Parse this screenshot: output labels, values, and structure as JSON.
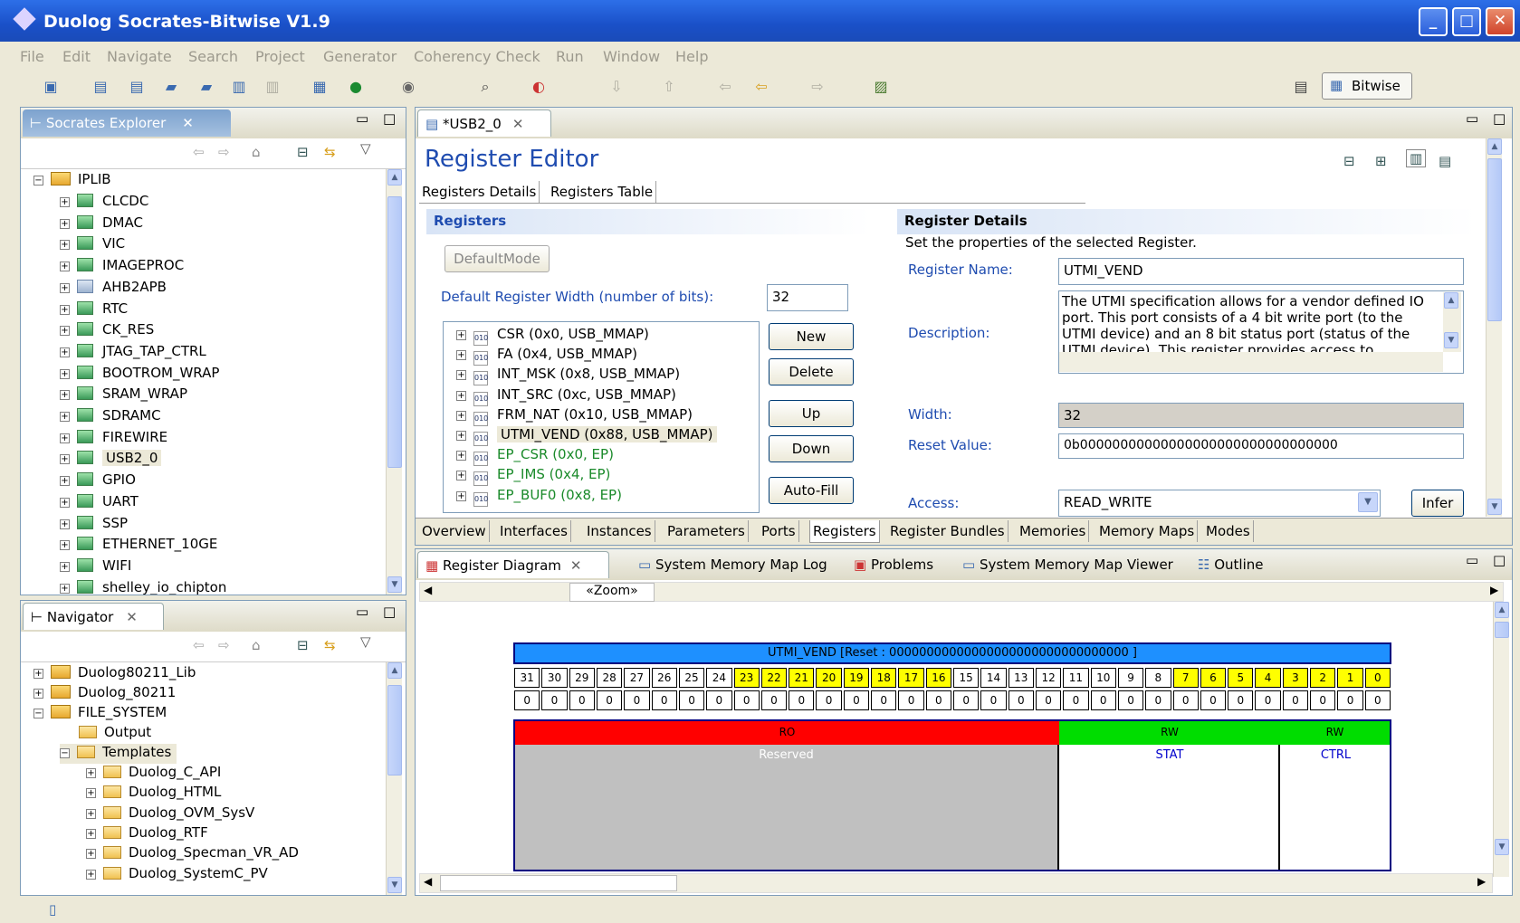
{
  "window": {
    "title": "Duolog Socrates-Bitwise V1.9"
  },
  "menu": [
    "File",
    "Edit",
    "Navigate",
    "Search",
    "Project",
    "Generator",
    "Coherency Check",
    "Run",
    "Window",
    "Help"
  ],
  "perspective": {
    "label": "Bitwise"
  },
  "explorer": {
    "title": "Socrates Explorer",
    "root": "IPLIB",
    "items": [
      "CLCDC",
      "DMAC",
      "VIC",
      "IMAGEPROC",
      "AHB2APB",
      "RTC",
      "CK_RES",
      "JTAG_TAP_CTRL",
      "BOOTROM_WRAP",
      "SRAM_WRAP",
      "SDRAMC",
      "FIREWIRE",
      "USB2_0",
      "GPIO",
      "UART",
      "SSP",
      "ETHERNET_10GE",
      "WIFI",
      "shelley_io_chipton"
    ]
  },
  "navigator": {
    "title": "Navigator",
    "projects": [
      "Duolog80211_Lib",
      "Duolog_80211",
      "FILE_SYSTEM"
    ],
    "folders": [
      "Output",
      "Templates"
    ],
    "templates": [
      "Duolog_C_API",
      "Duolog_HTML",
      "Duolog_OVM_SysV",
      "Duolog_RTF",
      "Duolog_Specman_VR_AD",
      "Duolog_SystemC_PV"
    ]
  },
  "editor": {
    "tab": "*USB2_0",
    "heading": "Register Editor",
    "subtabs": [
      "Registers Details",
      "Registers Table"
    ],
    "registers_section": "Registers",
    "default_mode_btn": "DefaultMode",
    "width_label": "Default Register Width (number of bits):",
    "width_value": "32",
    "register_list": [
      {
        "name": "CSR (0x0, USB_MMAP)",
        "green": false
      },
      {
        "name": "FA (0x4, USB_MMAP)",
        "green": false
      },
      {
        "name": "INT_MSK (0x8, USB_MMAP)",
        "green": false
      },
      {
        "name": "INT_SRC (0xc, USB_MMAP)",
        "green": false
      },
      {
        "name": "FRM_NAT (0x10, USB_MMAP)",
        "green": false
      },
      {
        "name": "UTMI_VEND (0x88, USB_MMAP)",
        "green": false
      },
      {
        "name": "EP_CSR (0x0, EP)",
        "green": true
      },
      {
        "name": "EP_IMS (0x4, EP)",
        "green": true
      },
      {
        "name": "EP_BUF0 (0x8, EP)",
        "green": true
      }
    ],
    "buttons": {
      "new": "New",
      "delete": "Delete",
      "up": "Up",
      "down": "Down",
      "autofill": "Auto-Fill",
      "infer": "Infer"
    },
    "details": {
      "title": "Register Details",
      "subtitle": "Set the properties of the selected Register.",
      "name_label": "Register Name:",
      "name_value": "UTMI_VEND",
      "desc_label": "Description:",
      "desc_value": "The UTMI specification allows for a vendor defined IO port. This port consists of a 4 bit write port (to the UTMI device) and an 8 bit status port (status of the UTMI device). This register provides access to",
      "width_label": "Width:",
      "width_value": "32",
      "reset_label": "Reset Value:",
      "reset_value": "0b00000000000000000000000000000000",
      "access_label": "Access:",
      "access_value": "READ_WRITE"
    },
    "bottom_tabs": [
      "Overview",
      "Interfaces",
      "Instances",
      "Parameters",
      "Ports",
      "Registers",
      "Register Bundles",
      "Memories",
      "Memory Maps",
      "Modes"
    ]
  },
  "diagram_views": {
    "tabs": [
      "Register Diagram",
      "System Memory Map Log",
      "Problems",
      "System Memory Map Viewer",
      "Outline"
    ],
    "zoom": "«Zoom»",
    "header": "UTMI_VEND  [Reset : 00000000000000000000000000000000 ]",
    "bits": [
      "31",
      "30",
      "29",
      "28",
      "27",
      "26",
      "25",
      "24",
      "23",
      "22",
      "21",
      "20",
      "19",
      "18",
      "17",
      "16",
      "15",
      "14",
      "13",
      "12",
      "11",
      "10",
      "9",
      "8",
      "7",
      "6",
      "5",
      "4",
      "3",
      "2",
      "1",
      "0"
    ],
    "reset_bit": "0",
    "fields": [
      {
        "access": "RO",
        "name": "Reserved",
        "color": "#ff0000"
      },
      {
        "access": "RW",
        "name": "STAT",
        "color": "#00dd00"
      },
      {
        "access": "RW",
        "name": "CTRL",
        "color": "#00dd00"
      }
    ]
  }
}
